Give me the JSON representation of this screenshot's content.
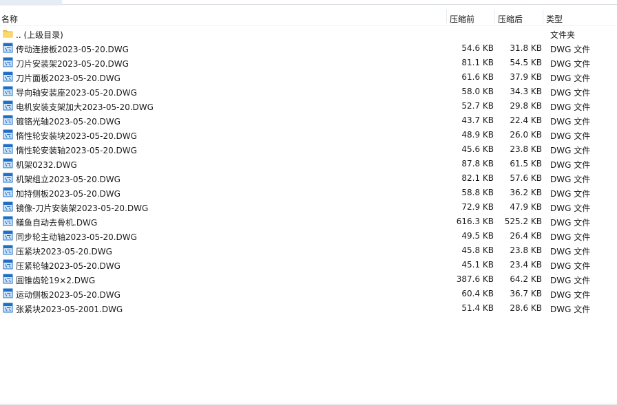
{
  "columns": {
    "name": "名称",
    "before": "压缩前",
    "after": "压缩后",
    "type": "类型"
  },
  "parent": {
    "name": ".. (上级目录)",
    "type": "文件夹",
    "icon": "folder-icon"
  },
  "files": [
    {
      "name": "传动连接板2023-05-20.DWG",
      "before": "54.6 KB",
      "after": "31.8 KB",
      "type": "DWG 文件"
    },
    {
      "name": "刀片安装架2023-05-20.DWG",
      "before": "81.1 KB",
      "after": "54.5 KB",
      "type": "DWG 文件"
    },
    {
      "name": "刀片面板2023-05-20.DWG",
      "before": "61.6 KB",
      "after": "37.9 KB",
      "type": "DWG 文件"
    },
    {
      "name": "导向轴安装座2023-05-20.DWG",
      "before": "58.0 KB",
      "after": "34.3 KB",
      "type": "DWG 文件"
    },
    {
      "name": "电机安装支架加大2023-05-20.DWG",
      "before": "52.7 KB",
      "after": "29.8 KB",
      "type": "DWG 文件"
    },
    {
      "name": "镀铬光轴2023-05-20.DWG",
      "before": "43.7 KB",
      "after": "22.4 KB",
      "type": "DWG 文件"
    },
    {
      "name": "惰性轮安装块2023-05-20.DWG",
      "before": "48.9 KB",
      "after": "26.0 KB",
      "type": "DWG 文件"
    },
    {
      "name": "惰性轮安装轴2023-05-20.DWG",
      "before": "45.6 KB",
      "after": "23.8 KB",
      "type": "DWG 文件"
    },
    {
      "name": "机架0232.DWG",
      "before": "87.8 KB",
      "after": "61.5 KB",
      "type": "DWG 文件"
    },
    {
      "name": "机架组立2023-05-20.DWG",
      "before": "82.1 KB",
      "after": "57.6 KB",
      "type": "DWG 文件"
    },
    {
      "name": "加持侧板2023-05-20.DWG",
      "before": "58.8 KB",
      "after": "36.2 KB",
      "type": "DWG 文件"
    },
    {
      "name": "镜像-刀片安装架2023-05-20.DWG",
      "before": "72.9 KB",
      "after": "47.9 KB",
      "type": "DWG 文件"
    },
    {
      "name": "鳝鱼自动去骨机.DWG",
      "before": "616.3 KB",
      "after": "525.2 KB",
      "type": "DWG 文件"
    },
    {
      "name": "同步轮主动轴2023-05-20.DWG",
      "before": "49.5 KB",
      "after": "26.4 KB",
      "type": "DWG 文件"
    },
    {
      "name": "压紧块2023-05-20.DWG",
      "before": "45.8 KB",
      "after": "23.8 KB",
      "type": "DWG 文件"
    },
    {
      "name": "压紧轮轴2023-05-20.DWG",
      "before": "45.1 KB",
      "after": "23.4 KB",
      "type": "DWG 文件"
    },
    {
      "name": "圆锥齿轮19×2.DWG",
      "before": "387.6 KB",
      "after": "64.2 KB",
      "type": "DWG 文件"
    },
    {
      "name": "运动侧板2023-05-20.DWG",
      "before": "60.4 KB",
      "after": "36.7 KB",
      "type": "DWG 文件"
    },
    {
      "name": "张紧块2023-05-2001.DWG",
      "before": "51.4 KB",
      "after": "28.6 KB",
      "type": "DWG 文件"
    }
  ],
  "colors": {
    "folder": "#f5c542",
    "dwg_icon": "#1f6fc5",
    "dwg_icon_light": "#cfe3f7"
  }
}
